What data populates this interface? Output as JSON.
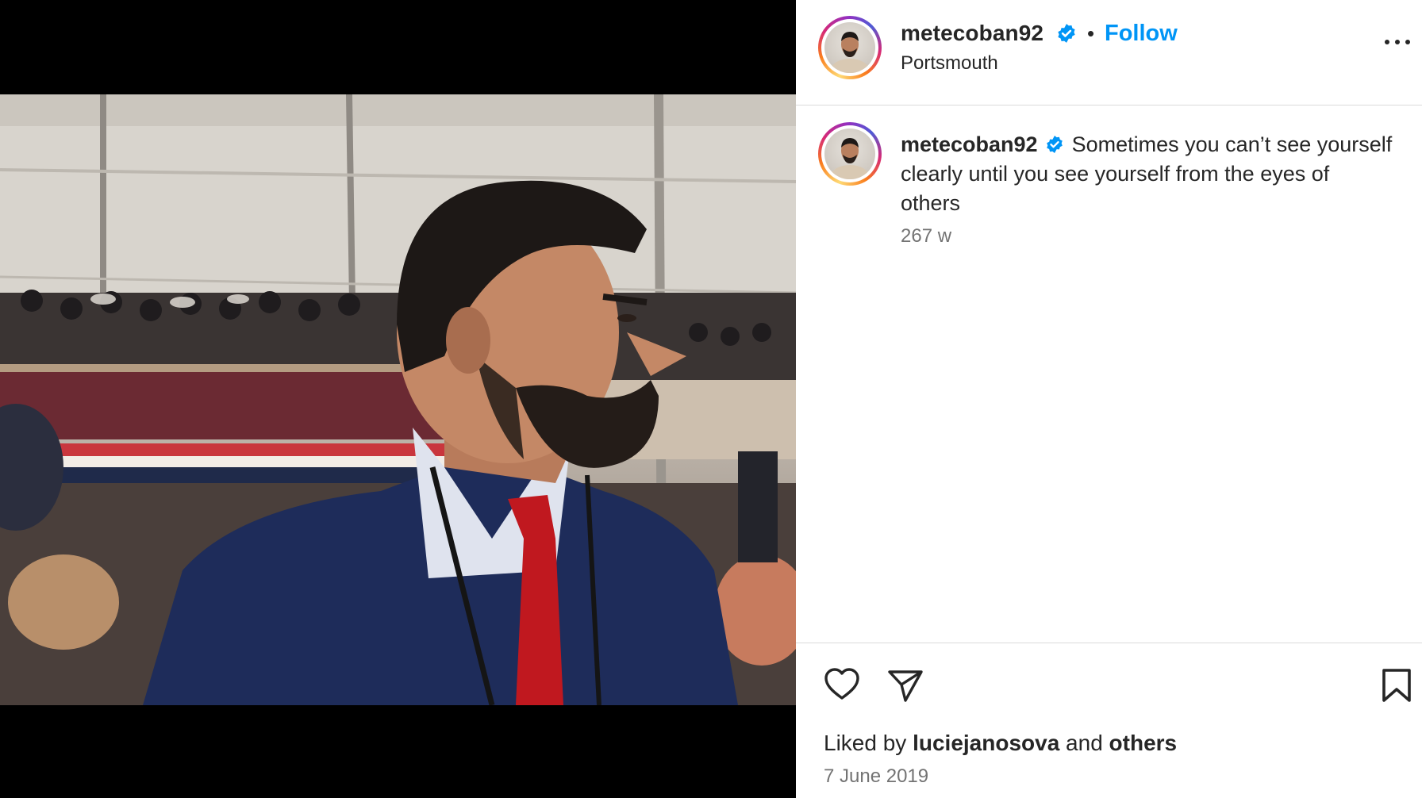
{
  "post": {
    "username": "metecoban92",
    "follow_label": "Follow",
    "separator": "•",
    "location": "Portsmouth",
    "caption_text": "Sometimes you can’t see yourself clearly until you see yourself from the eyes of others",
    "caption_time": "267 w",
    "liked_by_prefix": "Liked by",
    "liked_by_user": "luciejanosova",
    "liked_by_and": "and",
    "liked_by_others": "others",
    "date": "7 June 2019"
  },
  "icons": {
    "verified": "verified-badge-icon",
    "more": "more-options-icon",
    "like": "heart-icon",
    "share": "paper-plane-icon",
    "save": "bookmark-icon"
  },
  "colors": {
    "accent": "#0095f6",
    "text": "#262626",
    "muted": "#737373",
    "divider": "#dbdbdb"
  }
}
